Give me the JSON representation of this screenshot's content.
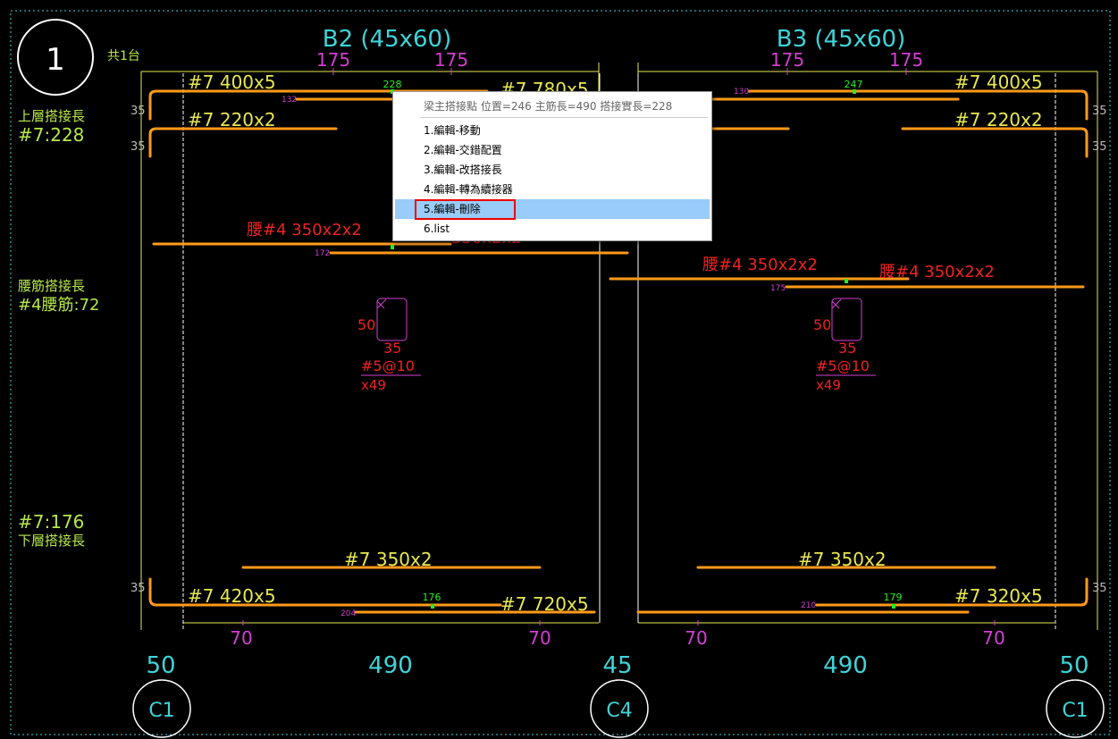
{
  "drawing": {
    "grid_mark": "1",
    "count_label": "共1台",
    "top_splice_label": "上層搭接長",
    "top_splice_value": "#7:228",
    "waist_splice_label": "腰筋搭接長",
    "waist_splice_value": "#4腰筋:72",
    "bottom_splice_value": "#7:176",
    "bottom_splice_label": "下層搭接長",
    "beams": [
      {
        "title": "B2 (45x60)",
        "top_dims": [
          "175",
          "175"
        ],
        "top_bar1": "#7 400x5",
        "top_bar1_splice": "228",
        "top_bar1_tag": "132",
        "top_bar2": "#7 780x5",
        "top_bar3": "#7 220x2",
        "waist_bar": "腰#4 350x2x2",
        "waist_bar_hidden": "350x2x2",
        "waist_tag": "172",
        "stirrup_hook": "50",
        "stirrup_width": "35",
        "stirrup_spec": "#5@10",
        "stirrup_count": "x49",
        "bottom_mid_bar": "#7 350x2",
        "bottom_bar1": "#7 420x5",
        "bottom_splice": "176",
        "bottom_tag": "204",
        "bottom_bar2": "#7 720x5",
        "bot_dims": [
          "70",
          "70"
        ],
        "span": "490",
        "left_hook_top": "35",
        "left_hook_mid": "35",
        "left_hook_bottom": "35"
      },
      {
        "title": "B3 (45x60)",
        "top_dims": [
          "175",
          "175"
        ],
        "top_bar1": "#7 400x5",
        "top_bar1_splice": "247",
        "top_bar1_tag": "130",
        "top_bar3": "#7 220x2",
        "waist_bar": "腰#4 350x2x2",
        "waist_bar2": "腰#4 350x2x2",
        "waist_tag": "175",
        "stirrup_hook": "50",
        "stirrup_width": "35",
        "stirrup_spec": "#5@10",
        "stirrup_count": "x49",
        "bottom_mid_bar": "#7 350x2",
        "bottom_bar1": "#7 320x5",
        "bottom_splice": "179",
        "bottom_tag": "210",
        "bot_dims": [
          "70",
          "70"
        ],
        "span": "490",
        "right_hook_top": "35",
        "right_hook_mid": "35",
        "right_hook_bottom": "35"
      }
    ],
    "support_widths": [
      "50",
      "45",
      "50"
    ],
    "columns": [
      "C1",
      "C4",
      "C1"
    ]
  },
  "context_menu": {
    "header": "梁主搭接點 位置=246 主筋長=490 搭接實長=228",
    "items": [
      "1.編輯-移動",
      "2.編輯-交錯配置",
      "3.編輯-改搭接長",
      "4.編輯-轉為續接器",
      "5.編輯-刪除",
      "6.list"
    ],
    "selected_index": 4
  },
  "colors": {
    "background": "#000000",
    "cyan": "#3fd3d8",
    "magenta": "#d33fd3",
    "yellow": "#e8e850",
    "orange": "#ff9a1a",
    "red": "#ee2222",
    "green": "#22ee22",
    "white": "#ffffff",
    "grey": "#bbbbbb",
    "lime": "#b7e84a"
  }
}
